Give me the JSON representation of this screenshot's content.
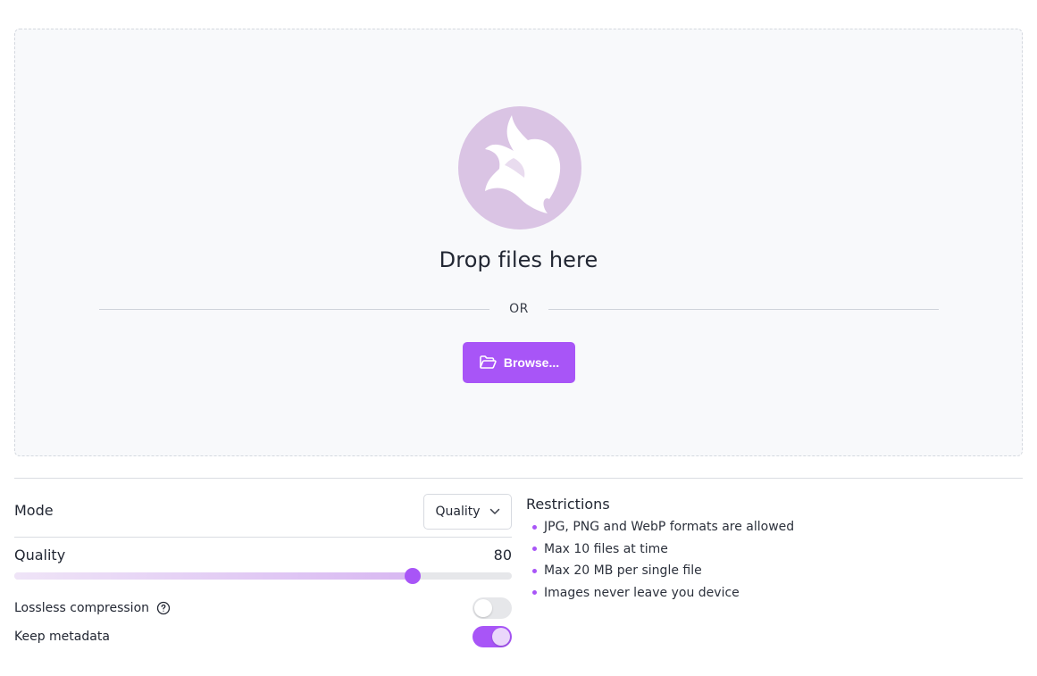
{
  "dropzone": {
    "title": "Drop files here",
    "or_text": "OR",
    "browse_label": "Browse...",
    "logo_icon": "bird-logo-icon",
    "browse_icon": "folder-open-icon"
  },
  "settings": {
    "mode_label": "Mode",
    "mode_value": "Quality",
    "mode_dropdown_icon": "chevron-down-icon",
    "quality_label": "Quality",
    "quality_value": "80",
    "quality_fraction": 0.8,
    "lossless_label": "Lossless compression",
    "lossless_help_icon": "question-circle-icon",
    "lossless_enabled": false,
    "metadata_label": "Keep metadata",
    "metadata_enabled": true
  },
  "restrictions": {
    "title": "Restrictions",
    "items": [
      "JPG, PNG and WebP formats are allowed",
      "Max 10 files at time",
      "Max 20 MB per single file",
      "Images never leave you device"
    ]
  },
  "colors": {
    "accent": "#a855f7",
    "logo_bg": "#dac4e4",
    "dropzone_bg": "#f8f9fb"
  }
}
